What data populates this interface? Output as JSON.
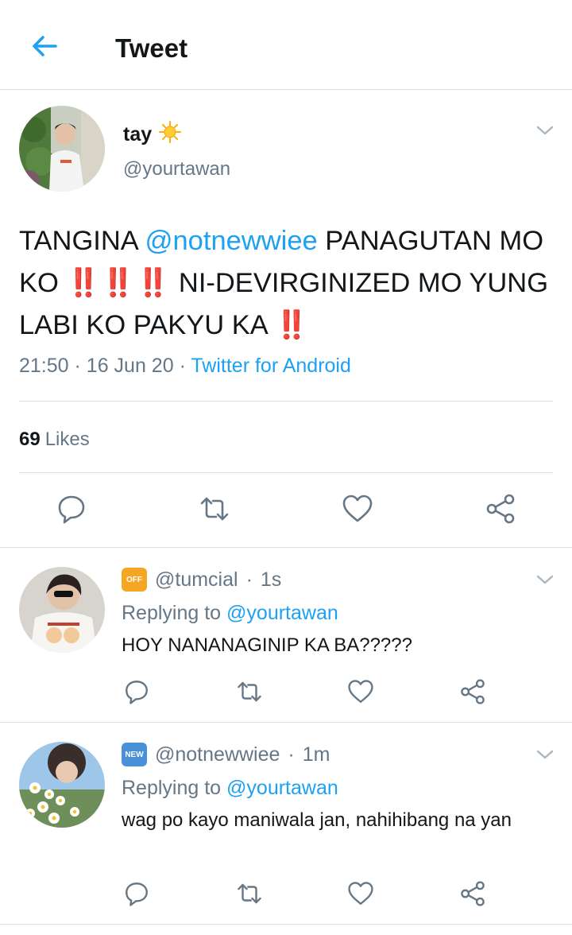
{
  "header": {
    "title": "Tweet"
  },
  "tweet": {
    "display_name": "tay",
    "handle": "@yourtawan",
    "text": {
      "part1": "TANGINA ",
      "mention": "@notnewwiee",
      "part2": " PANAGUTAN MO KO ",
      "bangs1": "‼️‼️‼️",
      "part3": " NI-DEVIRGINIZED MO YUNG LABI KO PAKYU KA ",
      "bangs2": "‼️"
    },
    "time": "21:50",
    "date": "16 Jun 20",
    "source": "Twitter for Android",
    "likes_count": "69",
    "likes_label": "Likes"
  },
  "replies": [
    {
      "badge": "OFF",
      "badge_color": "#f5a623",
      "handle": "@tumcial",
      "time": "1s",
      "replying_prefix": "Replying to",
      "replying_to": "@yourtawan",
      "text": "HOY NANANAGINIP KA BA?????"
    },
    {
      "badge": "NEW",
      "badge_color": "#4a90d9",
      "handle": "@notnewwiee",
      "time": "1m",
      "replying_prefix": "Replying to",
      "replying_to": "@yourtawan",
      "text": "wag po kayo maniwala jan, nahihibang na yan"
    }
  ],
  "colors": {
    "accent": "#1da1f2",
    "secondary_text": "#657786",
    "divider": "#d8dfe5",
    "alert_red": "#e0102a"
  },
  "icons": [
    "back-arrow-icon",
    "sun-icon",
    "chevron-down-icon",
    "reply-icon",
    "retweet-icon",
    "like-icon",
    "share-icon"
  ]
}
